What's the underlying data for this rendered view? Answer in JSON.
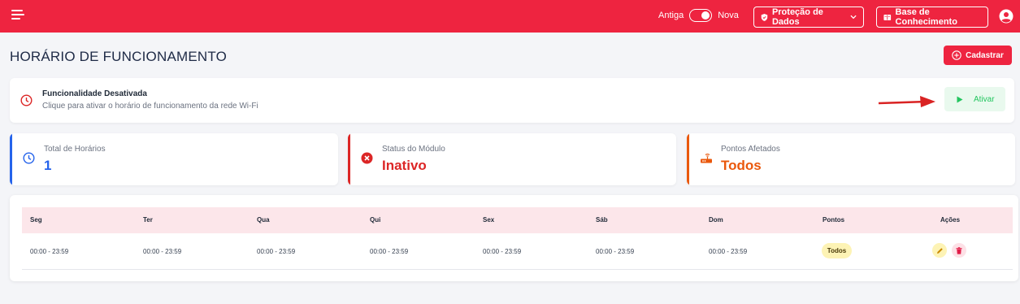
{
  "topbar": {
    "toggle_left_label": "Antiga",
    "toggle_right_label": "Nova",
    "protecao_label": "Proteção de Dados",
    "base_label": "Base de Conhecimento",
    "accent_color": "#ee2440"
  },
  "header": {
    "title": "HORÁRIO DE FUNCIONAMENTO",
    "cadastrar_label": "Cadastrar"
  },
  "banner": {
    "title": "Funcionalidade Desativada",
    "subtitle": "Clique para ativar o horário de funcionamento da rede Wi-Fi",
    "ativar_label": "Ativar"
  },
  "cards": [
    {
      "label": "Total de Horários",
      "value": "1",
      "color": "#2563eb",
      "icon": "clock-icon"
    },
    {
      "label": "Status do Módulo",
      "value": "Inativo",
      "color": "#dc2626",
      "icon": "x-circle-icon"
    },
    {
      "label": "Pontos Afetados",
      "value": "Todos",
      "color": "#ea580c",
      "icon": "router-icon"
    }
  ],
  "table": {
    "headers": [
      "Seg",
      "Ter",
      "Qua",
      "Qui",
      "Sex",
      "Sáb",
      "Dom",
      "Pontos",
      "Ações"
    ],
    "rows": [
      {
        "seg": "00:00 - 23:59",
        "ter": "00:00 - 23:59",
        "qua": "00:00 - 23:59",
        "qui": "00:00 - 23:59",
        "sex": "00:00 - 23:59",
        "sab": "00:00 - 23:59",
        "dom": "00:00 - 23:59",
        "pontos": "Todos"
      }
    ]
  }
}
